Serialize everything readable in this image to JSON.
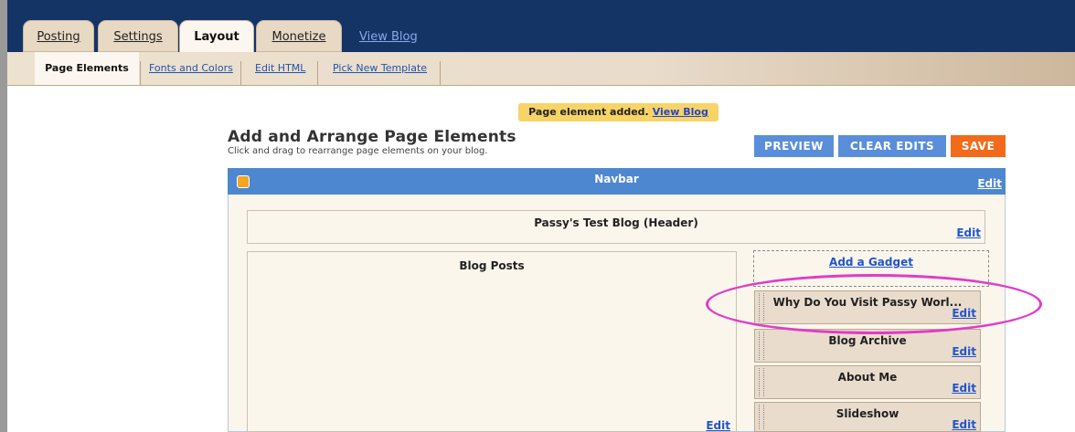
{
  "tabs": [
    {
      "label": "Posting"
    },
    {
      "label": "Settings"
    },
    {
      "label": "Layout"
    },
    {
      "label": "Monetize"
    }
  ],
  "view_blog_tab": "View Blog",
  "subtabs": [
    {
      "label": "Page Elements"
    },
    {
      "label": "Fonts and Colors"
    },
    {
      "label": "Edit HTML"
    },
    {
      "label": "Pick New Template"
    }
  ],
  "notice": {
    "text": "Page element added.",
    "link": "View Blog"
  },
  "page": {
    "title": "Add and Arrange Page Elements",
    "subtitle": "Click and drag to rearrange page elements on your blog."
  },
  "buttons": {
    "preview": "PREVIEW",
    "clear": "CLEAR EDITS",
    "save": "SAVE"
  },
  "navbar": {
    "title": "Navbar",
    "edit": "Edit"
  },
  "header_box": {
    "title": "Passy's Test Blog (Header)",
    "edit": "Edit"
  },
  "blog_posts": {
    "title": "Blog Posts",
    "edit": "Edit"
  },
  "add_gadget": "Add a Gadget",
  "gadgets": [
    {
      "title": "Why Do You Visit Passy Worl...",
      "edit": "Edit"
    },
    {
      "title": "Blog Archive",
      "edit": "Edit"
    },
    {
      "title": "About Me",
      "edit": "Edit"
    },
    {
      "title": "Slideshow",
      "edit": "Edit"
    }
  ],
  "colors": {
    "topbar": "#153466",
    "navbar": "#4d87d0",
    "save": "#f26a1b",
    "highlight": "#e03cc8"
  }
}
